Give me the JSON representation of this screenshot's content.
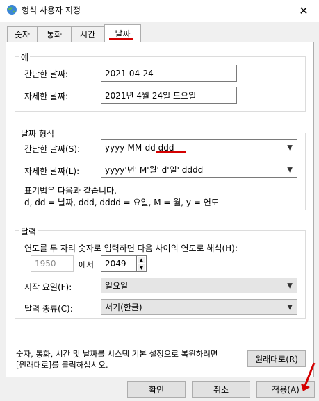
{
  "window": {
    "title": "형식 사용자 지정",
    "icon": "globe-icon",
    "close_icon": "close-icon"
  },
  "tabs": [
    {
      "label": "숫자",
      "active": false
    },
    {
      "label": "통화",
      "active": false
    },
    {
      "label": "시간",
      "active": false
    },
    {
      "label": "날짜",
      "active": true
    }
  ],
  "example": {
    "legend": "예",
    "short_label": "간단한 날짜:",
    "short_value": "2021-04-24",
    "long_label": "자세한 날짜:",
    "long_value": "2021년 4월 24일 토요일"
  },
  "format": {
    "legend": "날짜 형식",
    "short_label": "간단한 날짜(S):",
    "short_value": "yyyy-MM-dd ddd",
    "long_label": "자세한 날짜(L):",
    "long_value": "yyyy'년' M'월' d'일' dddd",
    "notation_title": "표기법은 다음과 같습니다.",
    "notation_text": "d, dd = 날짜,  ddd, dddd = 요일,  M = 월,  y = 연도"
  },
  "calendar": {
    "legend": "달력",
    "two_digit_label": "연도를 두 자리 숫자로 입력하면 다음 사이의 연도로 해석(H):",
    "year_from": "1950",
    "between_label": "에서",
    "year_to": "2049",
    "first_day_label": "시작 요일(F):",
    "first_day_value": "일요일",
    "calendar_type_label": "달력 종류(C):",
    "calendar_type_value": "서기(한글)"
  },
  "reset": {
    "text_line1": "숫자, 통화, 시간 및 날짜를 시스템 기본 설정으로 복원하려면",
    "text_line2": "[원래대로]를 클릭하십시오.",
    "button": "원래대로(R)"
  },
  "buttons": {
    "ok": "확인",
    "cancel": "취소",
    "apply": "적용(A)"
  },
  "colors": {
    "annotation": "#d40000"
  }
}
